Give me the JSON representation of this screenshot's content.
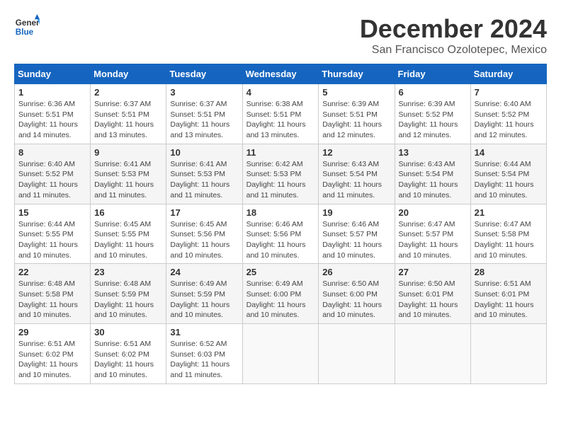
{
  "logo": {
    "line1": "General",
    "line2": "Blue"
  },
  "title": "December 2024",
  "location": "San Francisco Ozolotepec, Mexico",
  "days_of_week": [
    "Sunday",
    "Monday",
    "Tuesday",
    "Wednesday",
    "Thursday",
    "Friday",
    "Saturday"
  ],
  "weeks": [
    [
      {
        "day": "1",
        "sunrise": "6:36 AM",
        "sunset": "5:51 PM",
        "daylight": "11 hours and 14 minutes."
      },
      {
        "day": "2",
        "sunrise": "6:37 AM",
        "sunset": "5:51 PM",
        "daylight": "11 hours and 13 minutes."
      },
      {
        "day": "3",
        "sunrise": "6:37 AM",
        "sunset": "5:51 PM",
        "daylight": "11 hours and 13 minutes."
      },
      {
        "day": "4",
        "sunrise": "6:38 AM",
        "sunset": "5:51 PM",
        "daylight": "11 hours and 13 minutes."
      },
      {
        "day": "5",
        "sunrise": "6:39 AM",
        "sunset": "5:51 PM",
        "daylight": "11 hours and 12 minutes."
      },
      {
        "day": "6",
        "sunrise": "6:39 AM",
        "sunset": "5:52 PM",
        "daylight": "11 hours and 12 minutes."
      },
      {
        "day": "7",
        "sunrise": "6:40 AM",
        "sunset": "5:52 PM",
        "daylight": "11 hours and 12 minutes."
      }
    ],
    [
      {
        "day": "8",
        "sunrise": "6:40 AM",
        "sunset": "5:52 PM",
        "daylight": "11 hours and 11 minutes."
      },
      {
        "day": "9",
        "sunrise": "6:41 AM",
        "sunset": "5:53 PM",
        "daylight": "11 hours and 11 minutes."
      },
      {
        "day": "10",
        "sunrise": "6:41 AM",
        "sunset": "5:53 PM",
        "daylight": "11 hours and 11 minutes."
      },
      {
        "day": "11",
        "sunrise": "6:42 AM",
        "sunset": "5:53 PM",
        "daylight": "11 hours and 11 minutes."
      },
      {
        "day": "12",
        "sunrise": "6:43 AM",
        "sunset": "5:54 PM",
        "daylight": "11 hours and 11 minutes."
      },
      {
        "day": "13",
        "sunrise": "6:43 AM",
        "sunset": "5:54 PM",
        "daylight": "11 hours and 10 minutes."
      },
      {
        "day": "14",
        "sunrise": "6:44 AM",
        "sunset": "5:54 PM",
        "daylight": "11 hours and 10 minutes."
      }
    ],
    [
      {
        "day": "15",
        "sunrise": "6:44 AM",
        "sunset": "5:55 PM",
        "daylight": "11 hours and 10 minutes."
      },
      {
        "day": "16",
        "sunrise": "6:45 AM",
        "sunset": "5:55 PM",
        "daylight": "11 hours and 10 minutes."
      },
      {
        "day": "17",
        "sunrise": "6:45 AM",
        "sunset": "5:56 PM",
        "daylight": "11 hours and 10 minutes."
      },
      {
        "day": "18",
        "sunrise": "6:46 AM",
        "sunset": "5:56 PM",
        "daylight": "11 hours and 10 minutes."
      },
      {
        "day": "19",
        "sunrise": "6:46 AM",
        "sunset": "5:57 PM",
        "daylight": "11 hours and 10 minutes."
      },
      {
        "day": "20",
        "sunrise": "6:47 AM",
        "sunset": "5:57 PM",
        "daylight": "11 hours and 10 minutes."
      },
      {
        "day": "21",
        "sunrise": "6:47 AM",
        "sunset": "5:58 PM",
        "daylight": "11 hours and 10 minutes."
      }
    ],
    [
      {
        "day": "22",
        "sunrise": "6:48 AM",
        "sunset": "5:58 PM",
        "daylight": "11 hours and 10 minutes."
      },
      {
        "day": "23",
        "sunrise": "6:48 AM",
        "sunset": "5:59 PM",
        "daylight": "11 hours and 10 minutes."
      },
      {
        "day": "24",
        "sunrise": "6:49 AM",
        "sunset": "5:59 PM",
        "daylight": "11 hours and 10 minutes."
      },
      {
        "day": "25",
        "sunrise": "6:49 AM",
        "sunset": "6:00 PM",
        "daylight": "11 hours and 10 minutes."
      },
      {
        "day": "26",
        "sunrise": "6:50 AM",
        "sunset": "6:00 PM",
        "daylight": "11 hours and 10 minutes."
      },
      {
        "day": "27",
        "sunrise": "6:50 AM",
        "sunset": "6:01 PM",
        "daylight": "11 hours and 10 minutes."
      },
      {
        "day": "28",
        "sunrise": "6:51 AM",
        "sunset": "6:01 PM",
        "daylight": "11 hours and 10 minutes."
      }
    ],
    [
      {
        "day": "29",
        "sunrise": "6:51 AM",
        "sunset": "6:02 PM",
        "daylight": "11 hours and 10 minutes."
      },
      {
        "day": "30",
        "sunrise": "6:51 AM",
        "sunset": "6:02 PM",
        "daylight": "11 hours and 10 minutes."
      },
      {
        "day": "31",
        "sunrise": "6:52 AM",
        "sunset": "6:03 PM",
        "daylight": "11 hours and 11 minutes."
      },
      null,
      null,
      null,
      null
    ]
  ],
  "labels": {
    "sunrise": "Sunrise:",
    "sunset": "Sunset:",
    "daylight": "Daylight:"
  }
}
